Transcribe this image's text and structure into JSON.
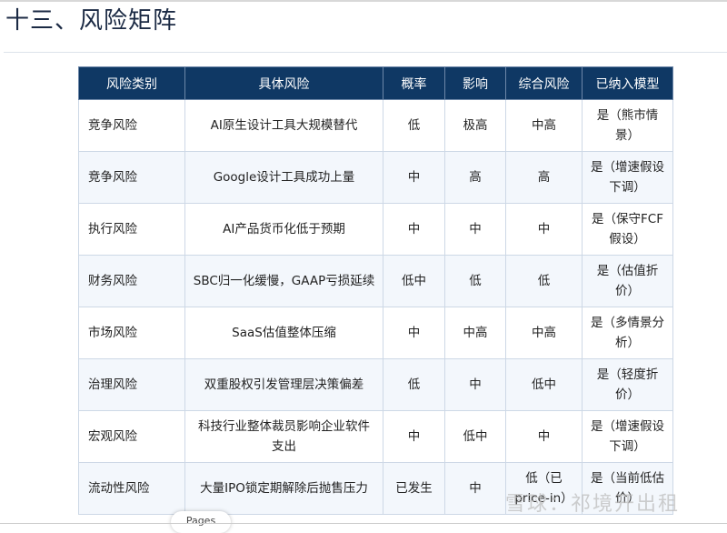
{
  "title": "十三、风险矩阵",
  "table": {
    "headers": [
      "风险类别",
      "具体风险",
      "概率",
      "影响",
      "综合风险",
      "已纳入模型"
    ],
    "rows": [
      [
        "竞争风险",
        "AI原生设计工具大规模替代",
        "低",
        "极高",
        "中高",
        "是（熊市情景）"
      ],
      [
        "竞争风险",
        "Google设计工具成功上量",
        "中",
        "高",
        "高",
        "是（增速假设下调）"
      ],
      [
        "执行风险",
        "AI产品货币化低于预期",
        "中",
        "中",
        "中",
        "是（保守FCF假设）"
      ],
      [
        "财务风险",
        "SBC归一化缓慢，GAAP亏损延续",
        "低中",
        "低",
        "低",
        "是（估值折价）"
      ],
      [
        "市场风险",
        "SaaS估值整体压缩",
        "中",
        "中高",
        "中高",
        "是（多情景分析）"
      ],
      [
        "治理风险",
        "双重股权引发管理层决策偏差",
        "低",
        "中",
        "低中",
        "是（轻度折价）"
      ],
      [
        "宏观风险",
        "科技行业整体裁员影响企业软件支出",
        "中",
        "低中",
        "中",
        "是（增速假设下调）"
      ],
      [
        "流动性风险",
        "大量IPO锁定期解除后抛售压力",
        "已发生",
        "中",
        "低（已price-in）",
        "是（当前低估价）"
      ]
    ]
  },
  "pages_label": "Pages",
  "watermark": "雪球：祁境开出租",
  "colors": {
    "header_bg": "#0f3864",
    "alt_row": "#f3f7fc",
    "title": "#1b2a44"
  }
}
